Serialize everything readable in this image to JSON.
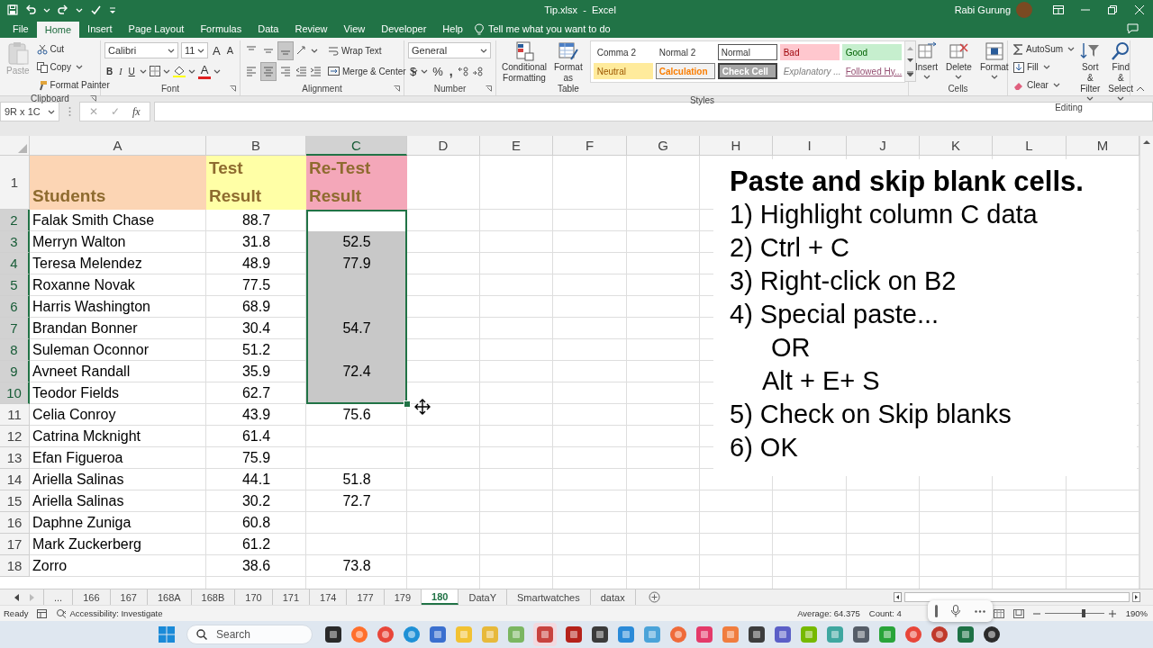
{
  "title_bar": {
    "title": "Tip.xlsx  -  Excel",
    "user": "Rabi Gurung"
  },
  "menu_tabs": [
    {
      "label": "File",
      "selected": false
    },
    {
      "label": "Home",
      "selected": true
    },
    {
      "label": "Insert",
      "selected": false
    },
    {
      "label": "Page Layout",
      "selected": false
    },
    {
      "label": "Formulas",
      "selected": false
    },
    {
      "label": "Data",
      "selected": false
    },
    {
      "label": "Review",
      "selected": false
    },
    {
      "label": "View",
      "selected": false
    },
    {
      "label": "Developer",
      "selected": false
    },
    {
      "label": "Help",
      "selected": false
    }
  ],
  "tell_me": "Tell me what you want to do",
  "ribbon": {
    "clipboard": {
      "paste": "Paste",
      "cut": "Cut",
      "copy": "Copy",
      "format_painter": "Format Painter",
      "label": "Clipboard"
    },
    "font": {
      "font_name": "Calibri",
      "font_size": "11",
      "grow": "A",
      "shrink": "A",
      "bold": "B",
      "italic": "I",
      "underline": "U",
      "font_color": "A",
      "label": "Font"
    },
    "alignment": {
      "vertical": [
        {
          "selected": false
        },
        {
          "selected": false
        },
        {
          "selected": true
        }
      ],
      "horizontal": [
        {
          "selected": false
        },
        {
          "selected": true
        },
        {
          "selected": false
        }
      ],
      "wrap_text": "Wrap Text",
      "merge_center": "Merge & Center",
      "label": "Alignment"
    },
    "number": {
      "format": "General",
      "currency": "$",
      "percent": "%",
      "comma": ",",
      "label": "Number"
    },
    "styles": {
      "conditional_formatting": "Conditional Formatting",
      "format_as_table": "Format as Table",
      "items": [
        {
          "label": "Comma 2",
          "kind": "plain",
          "selected": false
        },
        {
          "label": "Normal 2",
          "kind": "plain",
          "selected": false
        },
        {
          "label": "Normal",
          "kind": "plain",
          "selected": true
        },
        {
          "label": "Bad",
          "kind": "bad",
          "selected": false
        },
        {
          "label": "Good",
          "kind": "good",
          "selected": false
        },
        {
          "label": "Neutral",
          "kind": "neutral",
          "selected": false
        },
        {
          "label": "Calculation",
          "kind": "calculation",
          "selected": false
        },
        {
          "label": "Check Cell",
          "kind": "check",
          "selected": false
        },
        {
          "label": "Explanatory ...",
          "kind": "explanatory",
          "selected": false
        },
        {
          "label": "Followed Hy...",
          "kind": "followed",
          "selected": false
        }
      ],
      "label": "Styles"
    },
    "cells": {
      "insert": "Insert",
      "delete": "Delete",
      "format": "Format",
      "label": "Cells"
    },
    "editing": {
      "autosum": "AutoSum",
      "fill": "Fill",
      "clear": "Clear",
      "sort_filter": "Sort & Filter",
      "find_select": "Find & Select",
      "label": "Editing"
    }
  },
  "formula_bar": {
    "name_box": "9R x 1C",
    "cancel": "✕",
    "enter": "✓",
    "fx": "fx"
  },
  "sheet": {
    "columns": [
      {
        "label": "A",
        "selected": false
      },
      {
        "label": "B",
        "selected": false
      },
      {
        "label": "C",
        "selected": true
      },
      {
        "label": "D",
        "selected": false
      },
      {
        "label": "E",
        "selected": false
      },
      {
        "label": "F",
        "selected": false
      },
      {
        "label": "G",
        "selected": false
      },
      {
        "label": "H",
        "selected": false
      },
      {
        "label": "I",
        "selected": false
      },
      {
        "label": "J",
        "selected": false
      },
      {
        "label": "K",
        "selected": false
      },
      {
        "label": "L",
        "selected": false
      },
      {
        "label": "M",
        "selected": false
      }
    ],
    "header_row": {
      "number": "1",
      "selected": false,
      "cells": [
        {
          "text": "Students",
          "color": "#fcd5b4"
        },
        {
          "text": "Test Result",
          "color": "#ffffa6"
        },
        {
          "text": "Re-Test Result",
          "color": "#f4a7b9"
        }
      ]
    },
    "rows": [
      {
        "number": "2",
        "student": "Falak Smith Chase",
        "test": "88.7",
        "selected": true,
        "active": true
      },
      {
        "number": "3",
        "student": "Merryn Walton",
        "test": "31.8",
        "retest": "52.5",
        "selected": true,
        "active": false
      },
      {
        "number": "4",
        "student": "Teresa Melendez",
        "test": "48.9",
        "retest": "77.9",
        "selected": true,
        "active": false
      },
      {
        "number": "5",
        "student": "Roxanne Novak",
        "test": "77.5",
        "selected": true,
        "active": false
      },
      {
        "number": "6",
        "student": "Harris Washington",
        "test": "68.9",
        "selected": true,
        "active": false
      },
      {
        "number": "7",
        "student": "Brandan Bonner",
        "test": "30.4",
        "retest": "54.7",
        "selected": true,
        "active": false
      },
      {
        "number": "8",
        "student": "Suleman Oconnor",
        "test": "51.2",
        "selected": true,
        "active": false
      },
      {
        "number": "9",
        "student": "Avneet Randall",
        "test": "35.9",
        "retest": "72.4",
        "selected": true,
        "active": false
      },
      {
        "number": "10",
        "student": "Teodor Fields",
        "test": "62.7",
        "selected": true,
        "active": false
      },
      {
        "number": "11",
        "student": "Celia Conroy",
        "test": "43.9",
        "retest": "75.6",
        "selected": false,
        "active": false
      },
      {
        "number": "12",
        "student": "Catrina Mcknight",
        "test": "61.4",
        "selected": false,
        "active": false
      },
      {
        "number": "13",
        "student": "Efan Figueroa",
        "test": "75.9",
        "selected": false,
        "active": false
      },
      {
        "number": "14",
        "student": "Ariella Salinas",
        "test": "44.1",
        "retest": "51.8",
        "selected": false,
        "active": false
      },
      {
        "number": "15",
        "student": "Ariella Salinas",
        "test": "30.2",
        "retest": "72.7",
        "selected": false,
        "active": false
      },
      {
        "number": "16",
        "student": "Daphne Zuniga",
        "test": "60.8",
        "selected": false,
        "active": false
      },
      {
        "number": "17",
        "student": "Mark Zuckerberg",
        "test": "61.2",
        "selected": false,
        "active": false
      },
      {
        "number": "18",
        "student": "Zorro",
        "test": "38.6",
        "retest": "73.8",
        "selected": false,
        "active": false
      }
    ],
    "text_box": {
      "lines": [
        {
          "text": "Paste and skip blank cells.",
          "kind": "title"
        },
        {
          "text": "1) Highlight column C data",
          "kind": "step"
        },
        {
          "text": "2) Ctrl + C",
          "kind": "step"
        },
        {
          "text": "3) Right-click on B2",
          "kind": "step"
        },
        {
          "text": "4) Special paste...",
          "kind": "step"
        },
        {
          "text": "OR",
          "kind": "indent_wide"
        },
        {
          "text": "Alt + E+ S",
          "kind": "indent"
        },
        {
          "text": "5) Check on Skip blanks",
          "kind": "step"
        },
        {
          "text": "6) OK",
          "kind": "step"
        }
      ]
    }
  },
  "sheet_tabs": {
    "more": "...",
    "tabs": [
      {
        "label": "166",
        "selected": false
      },
      {
        "label": "167",
        "selected": false
      },
      {
        "label": "168A",
        "selected": false
      },
      {
        "label": "168B",
        "selected": false
      },
      {
        "label": "170",
        "selected": false
      },
      {
        "label": "171",
        "selected": false
      },
      {
        "label": "174",
        "selected": false
      },
      {
        "label": "177",
        "selected": false
      },
      {
        "label": "179",
        "selected": false
      },
      {
        "label": "180",
        "selected": true
      },
      {
        "label": "DataY",
        "selected": false
      },
      {
        "label": "Smartwatches",
        "selected": false
      },
      {
        "label": "datax",
        "selected": false
      }
    ]
  },
  "status": {
    "ready": "Ready",
    "accessibility": "Accessibility: Investigate",
    "average": "Average: 64.375",
    "count": "Count: 4",
    "zoom": {
      "level": 0.65,
      "reading": "190%"
    }
  },
  "taskbar": {
    "search": {
      "placeholder": "Search"
    }
  }
}
